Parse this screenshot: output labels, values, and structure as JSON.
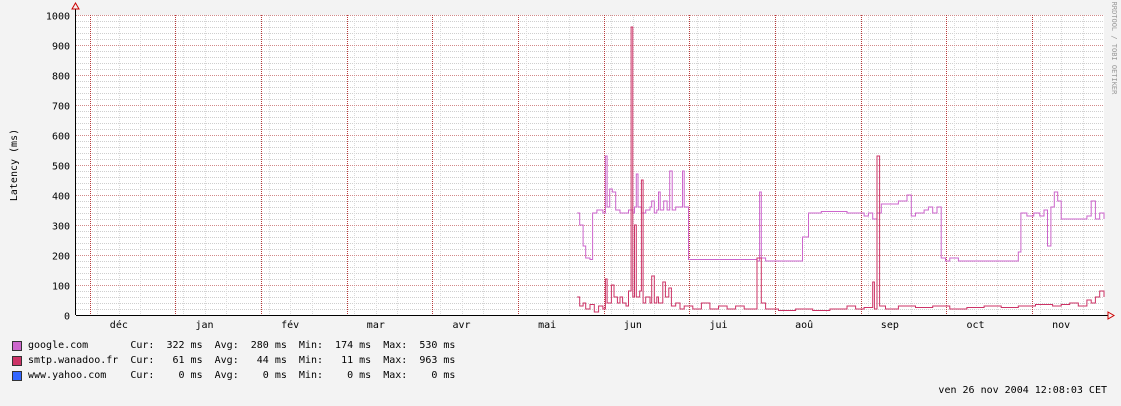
{
  "chart_data": {
    "type": "line",
    "ylabel": "Latency (ms)",
    "watermark": "RRDTOOL / TOBI OETIKER",
    "ylim": [
      0,
      1000
    ],
    "yticks": [
      0,
      100,
      200,
      300,
      400,
      500,
      600,
      700,
      800,
      900,
      1000
    ],
    "xlim": [
      0,
      12
    ],
    "months": [
      {
        "label": "déc",
        "x": 0.5
      },
      {
        "label": "jan",
        "x": 1.5
      },
      {
        "label": "fév",
        "x": 2.5
      },
      {
        "label": "mar",
        "x": 3.5
      },
      {
        "label": "avr",
        "x": 4.5
      },
      {
        "label": "mai",
        "x": 5.5
      },
      {
        "label": "jun",
        "x": 6.5
      },
      {
        "label": "jui",
        "x": 7.5
      },
      {
        "label": "aoû",
        "x": 8.5
      },
      {
        "label": "sep",
        "x": 9.5
      },
      {
        "label": "oct",
        "x": 10.5
      },
      {
        "label": "nov",
        "x": 11.5
      }
    ],
    "month_boundaries": [
      0,
      1,
      2,
      3,
      4,
      5,
      6,
      7,
      8,
      9,
      10,
      11
    ],
    "series": [
      {
        "name": "google.com",
        "color": "#cc66cc",
        "points": [
          [
            5.85,
            340
          ],
          [
            5.88,
            300
          ],
          [
            5.92,
            230
          ],
          [
            5.95,
            190
          ],
          [
            6.0,
            185
          ],
          [
            6.03,
            340
          ],
          [
            6.08,
            350
          ],
          [
            6.12,
            350
          ],
          [
            6.15,
            340
          ],
          [
            6.18,
            530
          ],
          [
            6.2,
            360
          ],
          [
            6.23,
            420
          ],
          [
            6.26,
            410
          ],
          [
            6.3,
            350
          ],
          [
            6.35,
            340
          ],
          [
            6.4,
            340
          ],
          [
            6.45,
            350
          ],
          [
            6.5,
            340
          ],
          [
            6.52,
            360
          ],
          [
            6.54,
            470
          ],
          [
            6.56,
            360
          ],
          [
            6.6,
            340
          ],
          [
            6.65,
            350
          ],
          [
            6.7,
            360
          ],
          [
            6.72,
            380
          ],
          [
            6.75,
            340
          ],
          [
            6.78,
            350
          ],
          [
            6.8,
            410
          ],
          [
            6.82,
            350
          ],
          [
            6.86,
            380
          ],
          [
            6.9,
            350
          ],
          [
            6.93,
            480
          ],
          [
            6.96,
            350
          ],
          [
            7.0,
            360
          ],
          [
            7.04,
            360
          ],
          [
            7.08,
            480
          ],
          [
            7.1,
            360
          ],
          [
            7.12,
            360
          ],
          [
            7.15,
            185
          ],
          [
            7.3,
            185
          ],
          [
            7.5,
            185
          ],
          [
            7.7,
            185
          ],
          [
            7.85,
            185
          ],
          [
            7.95,
            180
          ],
          [
            7.98,
            410
          ],
          [
            8.0,
            190
          ],
          [
            8.05,
            180
          ],
          [
            8.3,
            180
          ],
          [
            8.45,
            180
          ],
          [
            8.48,
            260
          ],
          [
            8.52,
            260
          ],
          [
            8.55,
            340
          ],
          [
            8.6,
            340
          ],
          [
            8.7,
            345
          ],
          [
            8.85,
            345
          ],
          [
            9.0,
            340
          ],
          [
            9.1,
            340
          ],
          [
            9.15,
            340
          ],
          [
            9.2,
            330
          ],
          [
            9.25,
            340
          ],
          [
            9.3,
            320
          ],
          [
            9.35,
            340
          ],
          [
            9.4,
            370
          ],
          [
            9.5,
            370
          ],
          [
            9.6,
            380
          ],
          [
            9.7,
            400
          ],
          [
            9.75,
            330
          ],
          [
            9.8,
            340
          ],
          [
            9.85,
            340
          ],
          [
            9.9,
            350
          ],
          [
            9.95,
            360
          ],
          [
            10.0,
            340
          ],
          [
            10.05,
            360
          ],
          [
            10.1,
            190
          ],
          [
            10.15,
            180
          ],
          [
            10.2,
            190
          ],
          [
            10.3,
            180
          ],
          [
            10.5,
            180
          ],
          [
            10.7,
            180
          ],
          [
            10.85,
            180
          ],
          [
            10.95,
            180
          ],
          [
            11.0,
            210
          ],
          [
            11.03,
            340
          ],
          [
            11.1,
            330
          ],
          [
            11.18,
            340
          ],
          [
            11.25,
            330
          ],
          [
            11.3,
            350
          ],
          [
            11.34,
            230
          ],
          [
            11.38,
            360
          ],
          [
            11.42,
            410
          ],
          [
            11.46,
            380
          ],
          [
            11.5,
            320
          ],
          [
            11.6,
            320
          ],
          [
            11.7,
            320
          ],
          [
            11.8,
            330
          ],
          [
            11.85,
            380
          ],
          [
            11.9,
            320
          ],
          [
            11.95,
            340
          ],
          [
            12.0,
            320
          ]
        ]
      },
      {
        "name": "smtp.wanadoo.fr",
        "color": "#cc3366",
        "points": [
          [
            5.85,
            60
          ],
          [
            5.88,
            30
          ],
          [
            5.92,
            40
          ],
          [
            5.95,
            20
          ],
          [
            6.0,
            35
          ],
          [
            6.05,
            10
          ],
          [
            6.1,
            30
          ],
          [
            6.15,
            20
          ],
          [
            6.18,
            120
          ],
          [
            6.2,
            40
          ],
          [
            6.25,
            100
          ],
          [
            6.28,
            60
          ],
          [
            6.32,
            40
          ],
          [
            6.35,
            60
          ],
          [
            6.38,
            40
          ],
          [
            6.42,
            30
          ],
          [
            6.45,
            80
          ],
          [
            6.48,
            960
          ],
          [
            6.5,
            60
          ],
          [
            6.52,
            300
          ],
          [
            6.54,
            60
          ],
          [
            6.58,
            80
          ],
          [
            6.6,
            450
          ],
          [
            6.62,
            40
          ],
          [
            6.65,
            60
          ],
          [
            6.7,
            40
          ],
          [
            6.72,
            130
          ],
          [
            6.75,
            40
          ],
          [
            6.78,
            60
          ],
          [
            6.8,
            40
          ],
          [
            6.85,
            110
          ],
          [
            6.88,
            60
          ],
          [
            6.92,
            90
          ],
          [
            6.95,
            30
          ],
          [
            7.0,
            40
          ],
          [
            7.05,
            20
          ],
          [
            7.1,
            30
          ],
          [
            7.2,
            20
          ],
          [
            7.3,
            40
          ],
          [
            7.4,
            20
          ],
          [
            7.5,
            30
          ],
          [
            7.6,
            20
          ],
          [
            7.7,
            30
          ],
          [
            7.8,
            20
          ],
          [
            7.95,
            190
          ],
          [
            8.0,
            40
          ],
          [
            8.05,
            20
          ],
          [
            8.2,
            15
          ],
          [
            8.4,
            20
          ],
          [
            8.6,
            15
          ],
          [
            8.8,
            20
          ],
          [
            9.0,
            30
          ],
          [
            9.1,
            20
          ],
          [
            9.2,
            25
          ],
          [
            9.3,
            110
          ],
          [
            9.32,
            20
          ],
          [
            9.35,
            530
          ],
          [
            9.38,
            30
          ],
          [
            9.45,
            20
          ],
          [
            9.6,
            30
          ],
          [
            9.8,
            25
          ],
          [
            10.0,
            30
          ],
          [
            10.2,
            20
          ],
          [
            10.4,
            25
          ],
          [
            10.6,
            30
          ],
          [
            10.8,
            25
          ],
          [
            11.0,
            30
          ],
          [
            11.2,
            35
          ],
          [
            11.4,
            30
          ],
          [
            11.5,
            35
          ],
          [
            11.6,
            40
          ],
          [
            11.7,
            30
          ],
          [
            11.8,
            50
          ],
          [
            11.85,
            40
          ],
          [
            11.9,
            60
          ],
          [
            11.95,
            80
          ],
          [
            12.0,
            60
          ]
        ]
      },
      {
        "name": "www.yahoo.com",
        "color": "#3366ff",
        "points": []
      }
    ]
  },
  "legend": [
    {
      "name": "google.com",
      "color": "#cc66cc",
      "text": "google.com       Cur:  322 ms  Avg:  280 ms  Min:  174 ms  Max:  530 ms"
    },
    {
      "name": "smtp.wanadoo.fr",
      "color": "#cc3366",
      "text": "smtp.wanadoo.fr  Cur:   61 ms  Avg:   44 ms  Min:   11 ms  Max:  963 ms"
    },
    {
      "name": "www.yahoo.com",
      "color": "#3366ff",
      "text": "www.yahoo.com    Cur:    0 ms  Avg:    0 ms  Min:    0 ms  Max:    0 ms"
    }
  ],
  "timestamp": "ven 26 nov 2004 12:08:03 CET"
}
